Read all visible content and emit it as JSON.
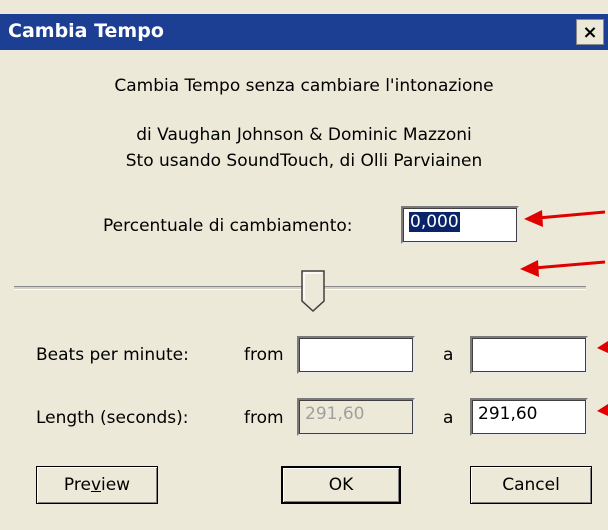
{
  "window": {
    "title": "Cambia Tempo",
    "close_glyph": "×"
  },
  "header": {
    "line1": "Cambia Tempo senza cambiare l'intonazione",
    "line2": "di Vaughan Johnson & Dominic Mazzoni",
    "line3": "Sto usando SoundTouch, di Olli Parviainen"
  },
  "percent": {
    "label": "Percentuale di cambiamento:",
    "value": "0,000"
  },
  "slider": {
    "value": 0
  },
  "bpm": {
    "label": "Beats per minute:",
    "from_label": "from",
    "from_value": "",
    "to_label": "a",
    "to_value": ""
  },
  "length": {
    "label": "Length (seconds):",
    "from_label": "from",
    "from_value": "291,60",
    "to_label": "a",
    "to_value": "291,60"
  },
  "buttons": {
    "preview_pre": "Pre",
    "preview_u": "v",
    "preview_post": "iew",
    "ok": "OK",
    "cancel": "Cancel"
  },
  "colors": {
    "titlebar": "#1c3f94",
    "arrow": "#e00000",
    "dialog_bg": "#ece9d8"
  }
}
